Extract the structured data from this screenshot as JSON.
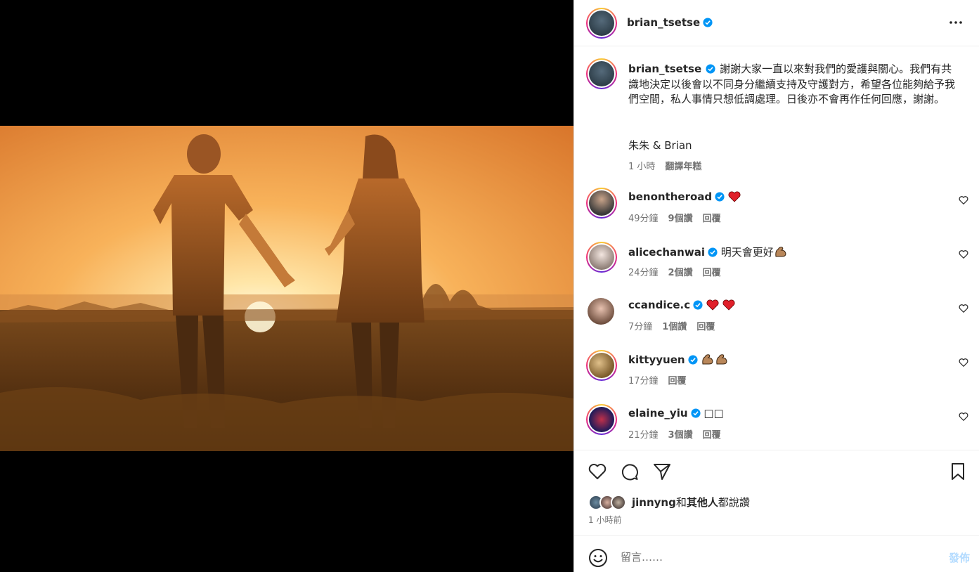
{
  "post": {
    "author": "brian_tsetse",
    "more_label": "•••"
  },
  "caption": {
    "author": "brian_tsetse",
    "text": "謝謝大家一直以來對我們的愛護與關心。我們有共識地決定以後會以不同身分繼續支持及守護對方，希望各位能夠給予我們空間，私人事情只想低調處理。日後亦不會再作任何回應，謝謝。",
    "signature": "朱朱 & Brian",
    "time": "1 小時",
    "translate": "翻譯年糕"
  },
  "comments": [
    {
      "user": "benontheroad",
      "text": "",
      "emoji": [
        "red-heart"
      ],
      "time": "49分鐘",
      "likes": "9個讚",
      "reply": "回覆"
    },
    {
      "user": "alicechanwai",
      "text": "明天會更好",
      "emoji": [
        "flexed-biceps"
      ],
      "time": "24分鐘",
      "likes": "2個讚",
      "reply": "回覆"
    },
    {
      "user": "ccandice.c",
      "text": "",
      "emoji": [
        "red-heart",
        "red-heart"
      ],
      "time": "7分鐘",
      "likes": "1個讚",
      "reply": "回覆"
    },
    {
      "user": "kittyyuen",
      "text": "",
      "emoji": [
        "flexed-biceps",
        "flexed-biceps"
      ],
      "time": "17分鐘",
      "likes": "",
      "reply": "回覆"
    },
    {
      "user": "elaine_yiu",
      "text": "□□",
      "emoji": [],
      "time": "21分鐘",
      "likes": "3個讚",
      "reply": "回覆"
    }
  ],
  "likes": {
    "user": "jinnyng",
    "connector": "和",
    "others": "其他人",
    "suffix": "都說讚"
  },
  "posted_time": "1 小時前",
  "comment_input": {
    "placeholder": "留言……",
    "post_label": "發佈"
  },
  "colors": {
    "verified": "#0095f6",
    "heart": "#ff3040",
    "post_button_disabled": "#b3dbff"
  }
}
